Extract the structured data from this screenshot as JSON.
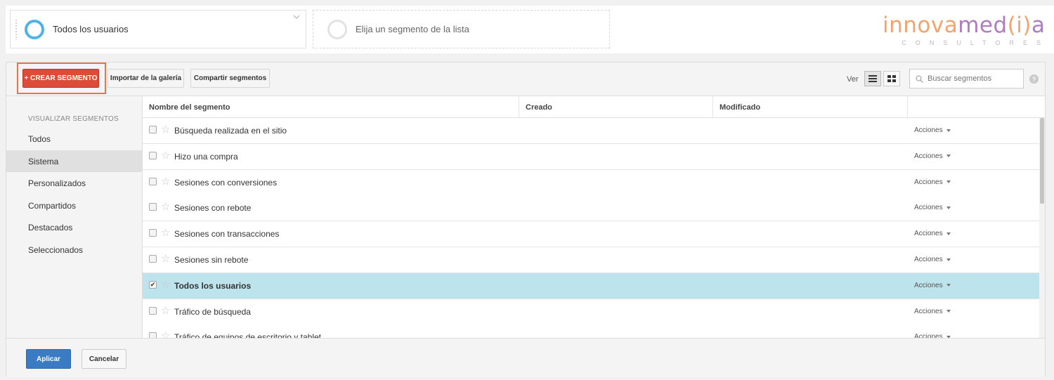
{
  "segment_bar": {
    "active_segment": "Todos los usuarios",
    "empty_slot": "Elija un segmento de la lista"
  },
  "logo": {
    "part_a": "innova",
    "part_b": "med",
    "part_c": "(i)",
    "part_d": "a",
    "subtitle": "CONSULTORES"
  },
  "toolbar": {
    "create_label": "+ CREAR SEGMENTO",
    "import_label": "Importar de la galería",
    "share_label": "Compartir segmentos",
    "view_label": "Ver",
    "search_placeholder": "Buscar segmentos",
    "help_label": "?"
  },
  "sidenav": {
    "heading": "VISUALIZAR SEGMENTOS",
    "items": [
      {
        "label": "Todos"
      },
      {
        "label": "Sistema"
      },
      {
        "label": "Personalizados"
      },
      {
        "label": "Compartidos"
      },
      {
        "label": "Destacados"
      },
      {
        "label": "Seleccionados"
      }
    ],
    "active": "Sistema"
  },
  "table": {
    "columns": [
      "Nombre del segmento",
      "Creado",
      "Modificado",
      ""
    ],
    "actions_label": "Acciones",
    "rows": [
      {
        "name": "Búsqueda realizada en el sitio",
        "checked": false
      },
      {
        "name": "Hizo una compra",
        "checked": false
      },
      {
        "name": "Sesiones con conversiones",
        "checked": false
      },
      {
        "name": "Sesiones con rebote",
        "checked": false
      },
      {
        "name": "Sesiones con transacciones",
        "checked": false
      },
      {
        "name": "Sesiones sin rebote",
        "checked": false
      },
      {
        "name": "Todos los usuarios",
        "checked": true
      },
      {
        "name": "Tráfico de búsqueda",
        "checked": false
      },
      {
        "name": "Tráfico de equipos de escritorio y tablet",
        "checked": false
      }
    ]
  },
  "footer": {
    "apply_label": "Aplicar",
    "cancel_label": "Cancelar"
  },
  "colors": {
    "create_button": "#dd4b39",
    "apply_button": "#3b7bc4",
    "selected_row": "#bde3ec",
    "highlight_border": "#f07241",
    "segment_ring": "#4fb3e8"
  }
}
